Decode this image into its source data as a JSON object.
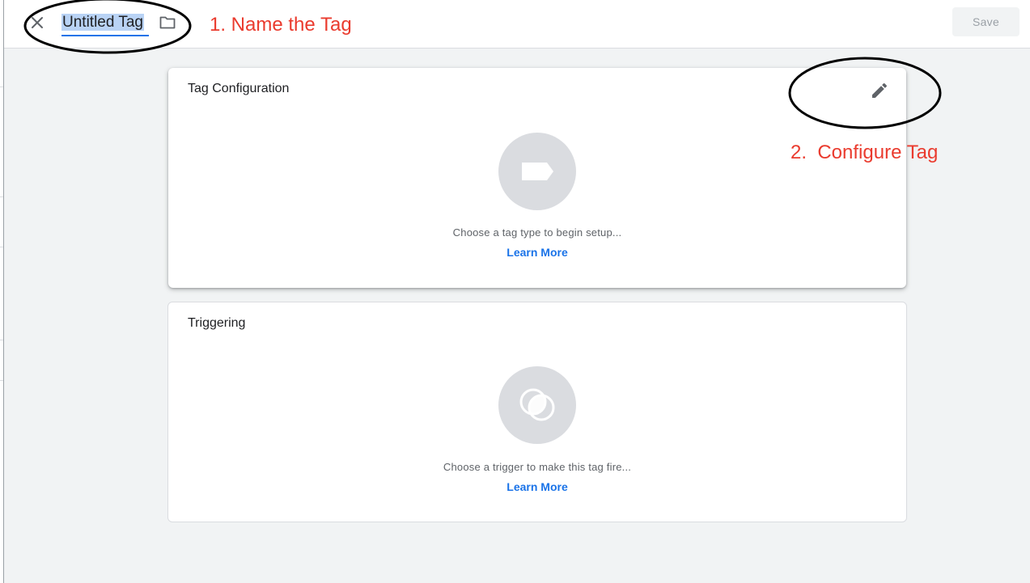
{
  "header": {
    "tag_name": "Untitled Tag",
    "save_label": "Save"
  },
  "annotations": {
    "step1": "1. Name the Tag",
    "step2": "2.  Configure Tag"
  },
  "cards": {
    "tag_configuration": {
      "title": "Tag Configuration",
      "hint": "Choose a tag type to begin setup...",
      "link": "Learn More"
    },
    "triggering": {
      "title": "Triggering",
      "hint": "Choose a trigger to make this tag fire...",
      "link": "Learn More"
    }
  },
  "icons": {
    "close": "close-icon",
    "folder": "folder-icon",
    "edit": "pencil-icon",
    "tag_type": "tag-shape-icon",
    "trigger": "overlapping-circles-icon"
  },
  "colors": {
    "accent": "#1a73e8",
    "annotation": "#ea3b2e",
    "icon_bg": "#dadce0",
    "text_selection": "#b9d3f5"
  }
}
